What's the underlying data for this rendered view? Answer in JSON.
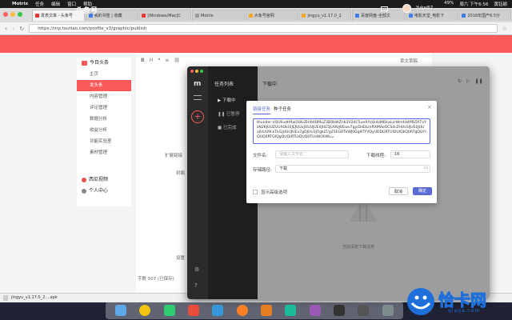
{
  "menubar": {
    "app": "Motrix",
    "items": [
      "任务",
      "编辑",
      "窗口",
      "帮助"
    ],
    "battery": "49%",
    "clock": "周六 下午6:56",
    "user": "黄钰颖"
  },
  "browser": {
    "tabs": [
      "发表文章 - 头条号",
      "我的书签 | 收藏",
      "[Windows/Mac]C",
      "Motrix",
      "大象号官网",
      "jingyu_v1.17.0_2",
      "百度网盘-全部文",
      "电影天堂_电影下",
      "2018年国产6.5分"
    ],
    "url": "https://mp.toutiao.com/profile_v3/graphic/publish"
  },
  "toutiao": {
    "logo": "头条号",
    "user": "Yukai67",
    "sidebar": {
      "group1": "今日头条",
      "items": [
        "主页",
        "发头条",
        "内容管理",
        "评论管理",
        "数据分析",
        "收益分析",
        "功能实验室",
        "素材管理"
      ],
      "group2": "西瓜视频",
      "group3": "个人中心"
    },
    "editor": {
      "draft": "草文草稿",
      "text1": "扩展链接",
      "text2": "封面",
      "text3": "设置",
      "count": "字数 507 (已保存)"
    },
    "download": "jingyu_v1.17.0_2....apk"
  },
  "motrix": {
    "list_title": "任务列表",
    "list_items": [
      "下载中",
      "已暂停",
      "已完成"
    ],
    "main_title": "下载中",
    "empty_text": "当前没有下载任务"
  },
  "dialog": {
    "tab_link": "链接任务",
    "tab_torrent": "种子任务",
    "url_text": "thunder://QUFodHRwOi8vZHl0dDMuZ3B0bWZnb3V2dC5ueXYzOi4zMDkxLzrWmtH4MS5hTvYzN2KJUUZUUXUkUlJEJUUxJUUUJUE0JUE5JUUUJUEwuTgyiDdDLmRXMAoOCSdrZHUUUJUE0JUUxJUUU9LkTkGJUUUJUEu7gDJUU3J7gkLT/g25EGRTkWJ0Gg9TYVQyUDDURTUlOUlQkQ0RTgQUYIQUQ0RTQlQgQUQlRTUlQUQ0TUsWOlIWv=",
    "label_name": "文件名:",
    "name_placeholder": "请输入文件名",
    "label_threads": "下载线程:",
    "threads_value": "16",
    "label_path": "存储路径:",
    "path_value": "下载",
    "advanced": "显示高级选项",
    "cancel": "取消",
    "ok": "确定"
  },
  "brand": {
    "text": "恰卡网",
    "sub": "qiaqa.com"
  },
  "colors": {
    "toutiao_red": "#f85959",
    "motrix_accent": "#5b6bd5",
    "motrix_dark": "#1f1f1f"
  }
}
